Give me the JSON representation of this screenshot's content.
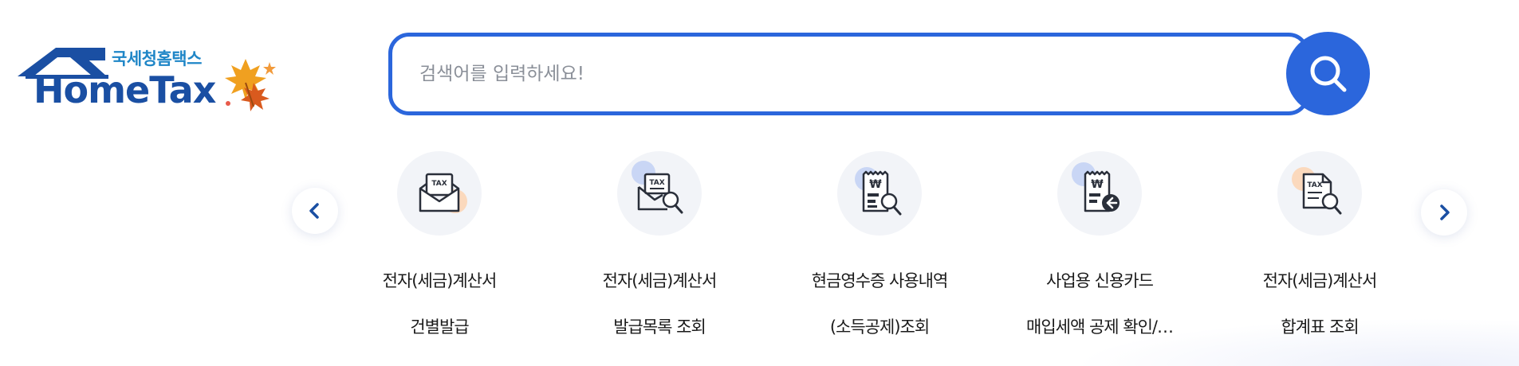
{
  "logo": {
    "subtitle": "국세청홈택스",
    "brand": "HomeTax",
    "colors": {
      "house": "#1a4fa3",
      "subtitle": "#1f86c7",
      "leaf": "#e58a1f"
    }
  },
  "search": {
    "placeholder": "검색어를 입력하세요!",
    "value": "",
    "accent_color": "#2b66dc",
    "button_icon": "search-icon"
  },
  "carousel": {
    "prev_icon": "chevron-left-icon",
    "next_icon": "chevron-right-icon",
    "items": [
      {
        "line1": "전자(세금)계산서",
        "line2": "건별발급",
        "icon": "tax-envelope-icon"
      },
      {
        "line1": "전자(세금)계산서",
        "line2": "발급목록 조회",
        "icon": "tax-envelope-search-icon"
      },
      {
        "line1": "현금영수증 사용내역",
        "line2": "(소득공제)조회",
        "icon": "won-receipt-search-icon"
      },
      {
        "line1": "사업용 신용카드",
        "line2": "매입세액 공제 확인/…",
        "icon": "won-receipt-return-icon"
      },
      {
        "line1": "전자(세금)계산서",
        "line2": "합계표 조회",
        "icon": "tax-document-search-icon"
      }
    ]
  }
}
